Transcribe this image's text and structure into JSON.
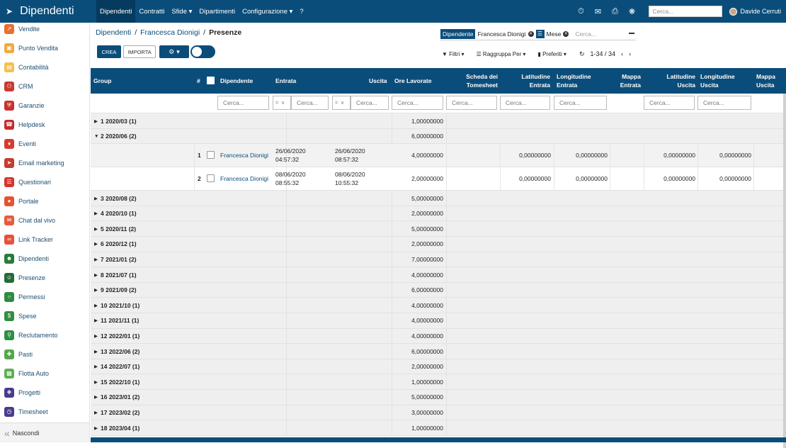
{
  "app": {
    "title": "Dipendenti"
  },
  "topnav": [
    "Dipendenti",
    "Contratti",
    "Sfide",
    "Dipartimenti",
    "Configurazione",
    "?"
  ],
  "topbar": {
    "search_placeholder": "Cerca...",
    "user_name": "Davide Cerruti"
  },
  "sidebar": {
    "items": [
      {
        "label": "Vendite",
        "color": "#e86f2f",
        "icon": "chart-line-icon"
      },
      {
        "label": "Punto Vendita",
        "color": "#f2a93b",
        "icon": "store-icon"
      },
      {
        "label": "Contabilità",
        "color": "#f4c04e",
        "icon": "ledger-icon"
      },
      {
        "label": "CRM",
        "color": "#c93a2f",
        "icon": "handshake-icon"
      },
      {
        "label": "Garanzie",
        "color": "#c9312c",
        "icon": "shield-icon"
      },
      {
        "label": "Helpdesk",
        "color": "#c62b2b",
        "icon": "headset-icon"
      },
      {
        "label": "Eventi",
        "color": "#d63b2f",
        "icon": "ticket-icon"
      },
      {
        "label": "Email marketing",
        "color": "#c93a2f",
        "icon": "paper-plane-icon"
      },
      {
        "label": "Questionari",
        "color": "#d6352e",
        "icon": "clipboard-icon"
      },
      {
        "label": "Portale",
        "color": "#e8512f",
        "icon": "globe-icon"
      },
      {
        "label": "Chat dal vivo",
        "color": "#e95a3a",
        "icon": "chat-icon"
      },
      {
        "label": "Link Tracker",
        "color": "#e8513c",
        "icon": "link-icon"
      },
      {
        "label": "Dipendenti",
        "color": "#2a7a3a",
        "icon": "users-icon"
      },
      {
        "label": "Presenze",
        "color": "#246b36",
        "icon": "user-check-icon"
      },
      {
        "label": "Permessi",
        "color": "#2e8b40",
        "icon": "calendar-icon"
      },
      {
        "label": "Spese",
        "color": "#2f8f42",
        "icon": "dollar-icon"
      },
      {
        "label": "Reclutamento",
        "color": "#2c8f44",
        "icon": "search-person-icon"
      },
      {
        "label": "Pasti",
        "color": "#55a84a",
        "icon": "fork-icon"
      },
      {
        "label": "Flotta Auto",
        "color": "#5fae52",
        "icon": "car-icon"
      },
      {
        "label": "Progetti",
        "color": "#4b3b8f",
        "icon": "puzzle-icon"
      },
      {
        "label": "Timesheet",
        "color": "#4b3b8f",
        "icon": "clock-icon"
      }
    ],
    "hide_label": "Nascondi"
  },
  "breadcrumb": {
    "root": "Dipendenti",
    "mid": "Francesca Dionigi",
    "current": "Presenze"
  },
  "buttons": {
    "create": "CREA",
    "import": "IMPORTA"
  },
  "facets": {
    "f1_label": "Dipendente",
    "f1_value": "Francesca Dionigi",
    "f2_value": "Mese",
    "search_placeholder": "Cerca..."
  },
  "toolbar": {
    "filters": "Filtri",
    "groupby": "Raggruppa Per",
    "favorites": "Preferiti",
    "pager": "1-34 / 34"
  },
  "columns": {
    "group": "Group",
    "num": "#",
    "employee": "Dipendente",
    "checkin": "Entrata",
    "checkout": "Uscita",
    "hours": "Ore Lavorate",
    "timesheet_l1": "Scheda dei",
    "timesheet_l2": "Tomesheet",
    "lat_in_l1": "Latitudine",
    "lat_in_l2": "Entrata",
    "lon_in_l1": "Longitudine",
    "lon_in_l2": "Entrata",
    "map_in_l1": "Mappa",
    "map_in_l2": "Entrata",
    "lat_out_l1": "Latitudine",
    "lat_out_l2": "Uscita",
    "lon_out_l1": "Longitudine",
    "lon_out_l2": "Uscita",
    "map_out_l1": "Mappa",
    "map_out_l2": "Uscita"
  },
  "filters": {
    "search": "Cerca...",
    "eq": "=",
    "chev": "∨"
  },
  "groups": [
    {
      "label": "1 2020/03 (1)",
      "sum": "1,00000000",
      "open": false
    },
    {
      "label": "2 2020/06 (2)",
      "sum": "6,00000000",
      "open": true
    },
    {
      "label": "3 2020/08 (2)",
      "sum": "5,00000000",
      "open": false
    },
    {
      "label": "4 2020/10 (1)",
      "sum": "2,00000000",
      "open": false
    },
    {
      "label": "5 2020/11 (2)",
      "sum": "5,00000000",
      "open": false
    },
    {
      "label": "6 2020/12 (1)",
      "sum": "2,00000000",
      "open": false
    },
    {
      "label": "7 2021/01 (2)",
      "sum": "7,00000000",
      "open": false
    },
    {
      "label": "8 2021/07 (1)",
      "sum": "4,00000000",
      "open": false
    },
    {
      "label": "9 2021/09 (2)",
      "sum": "6,00000000",
      "open": false
    },
    {
      "label": "10 2021/10 (1)",
      "sum": "4,00000000",
      "open": false
    },
    {
      "label": "11 2021/11 (1)",
      "sum": "4,00000000",
      "open": false
    },
    {
      "label": "12 2022/01 (1)",
      "sum": "4,00000000",
      "open": false
    },
    {
      "label": "13 2022/06 (2)",
      "sum": "6,00000000",
      "open": false
    },
    {
      "label": "14 2022/07 (1)",
      "sum": "2,00000000",
      "open": false
    },
    {
      "label": "15 2022/10 (1)",
      "sum": "1,00000000",
      "open": false
    },
    {
      "label": "16 2023/01 (2)",
      "sum": "5,00000000",
      "open": false
    },
    {
      "label": "17 2023/02 (2)",
      "sum": "3,00000000",
      "open": false
    },
    {
      "label": "18 2023/04 (1)",
      "sum": "1,00000000",
      "open": false
    }
  ],
  "records": [
    {
      "num": "1",
      "employee": "Francesca Dionigi",
      "checkin_date": "26/06/2020",
      "checkin_time": "04:57:32",
      "checkout_date": "26/06/2020",
      "checkout_time": "08:57:32",
      "hours": "4,00000000",
      "lat_in": "0,00000000",
      "lon_in": "0,00000000",
      "lat_out": "0,00000000",
      "lon_out": "0,00000000"
    },
    {
      "num": "2",
      "employee": "Francesca Dionigi",
      "checkin_date": "08/06/2020",
      "checkin_time": "08:55:32",
      "checkout_date": "08/06/2020",
      "checkout_time": "10:55:32",
      "hours": "2,00000000",
      "lat_in": "0,00000000",
      "lon_in": "0,00000000",
      "lat_out": "0,00000000",
      "lon_out": "0,00000000"
    }
  ],
  "colors": {
    "primary": "#0b4d7a",
    "group_bg": "#efefef"
  }
}
